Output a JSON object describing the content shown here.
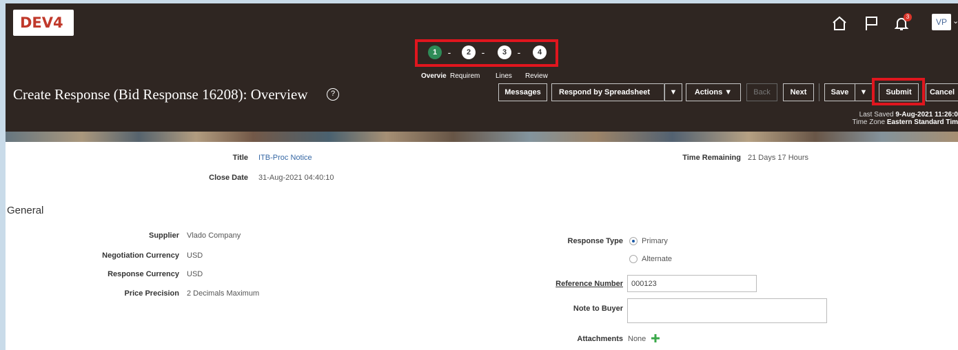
{
  "app": {
    "env": "DEV4",
    "user_initials": "VP",
    "notification_count": "3"
  },
  "icons": {
    "home": "home-icon",
    "flag": "flag-icon",
    "bell": "bell-icon",
    "help": "help-icon",
    "add": "plus-icon"
  },
  "train": {
    "stops": [
      {
        "num": "1",
        "label": "Overview",
        "label_shown": "Overvie",
        "state": "current"
      },
      {
        "num": "2",
        "label_shown": "Requirem",
        "state": "todo"
      },
      {
        "num": "3",
        "label_shown": "Lines",
        "state": "todo"
      },
      {
        "num": "4",
        "label_shown": "Review",
        "state": "todo"
      }
    ],
    "separator": "-"
  },
  "page": {
    "title": "Create Response (Bid Response 16208): Overview",
    "help": "?"
  },
  "toolbar": {
    "messages": "Messages",
    "respond_spreadsheet": "Respond by Spreadsheet",
    "dropdown_caret": "▼",
    "actions": "Actions",
    "back": "Back",
    "next": "Next",
    "save": "Save",
    "submit": "Submit",
    "cancel": "Cancel"
  },
  "status": {
    "last_saved_label": "Last Saved",
    "last_saved_value": "9-Aug-2021 11:26:0",
    "time_zone_label": "Time Zone",
    "time_zone_value": "Eastern Standard Tim"
  },
  "summary": {
    "title_label": "Title",
    "title_value": "ITB-Proc Notice",
    "close_date_label": "Close Date",
    "close_date_value": "31-Aug-2021 04:40:10",
    "time_remaining_label": "Time Remaining",
    "time_remaining_value": "21 Days 17 Hours"
  },
  "general": {
    "section_title": "General",
    "supplier_label": "Supplier",
    "supplier_value": "Vlado Company",
    "neg_currency_label": "Negotiation Currency",
    "neg_currency_value": "USD",
    "resp_currency_label": "Response Currency",
    "resp_currency_value": "USD",
    "price_precision_label": "Price Precision",
    "price_precision_value": "2 Decimals Maximum",
    "response_type_label": "Response Type",
    "response_type_options": [
      "Primary",
      "Alternate"
    ],
    "response_type_selected": "Primary",
    "reference_number_label": "Reference Number",
    "reference_number_value": "000123",
    "note_to_buyer_label": "Note to Buyer",
    "note_to_buyer_value": "",
    "attachments_label": "Attachments",
    "attachments_value": "None"
  },
  "colors": {
    "header_bg": "#2f2622",
    "current_step": "#2e8b57",
    "highlight": "#e0161e",
    "link": "#3567a4",
    "env": "#c0392b"
  }
}
